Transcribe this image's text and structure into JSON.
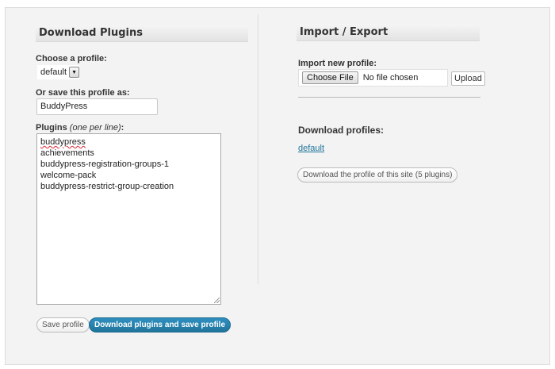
{
  "left": {
    "title": "Download Plugins",
    "choose_profile_label": "Choose a profile:",
    "profile_selected": "default",
    "save_as_label": "Or save this profile as:",
    "save_as_value": "BuddyPress",
    "plugins_label": "Plugins",
    "plugins_hint": "(one per line)",
    "plugins_colon": ":",
    "plugins": [
      "buddypress",
      "achievements",
      "buddypress-registration-groups-1",
      "welcome-pack",
      "buddypress-restrict-group-creation"
    ],
    "save_profile_button": "Save profile",
    "download_save_button": "Download plugins and save profile"
  },
  "right": {
    "title": "Import / Export",
    "import_label": "Import new profile:",
    "choose_file_button": "Choose File",
    "file_status": "No file chosen",
    "upload_button": "Upload",
    "download_profiles_label": "Download profiles:",
    "profile_link": "default",
    "download_site_profile_button": "Download the profile of this site (5 plugins)"
  },
  "colors": {
    "primary_button": "#21759b",
    "link": "#21759b",
    "panel_bg": "#f3f3f3"
  }
}
